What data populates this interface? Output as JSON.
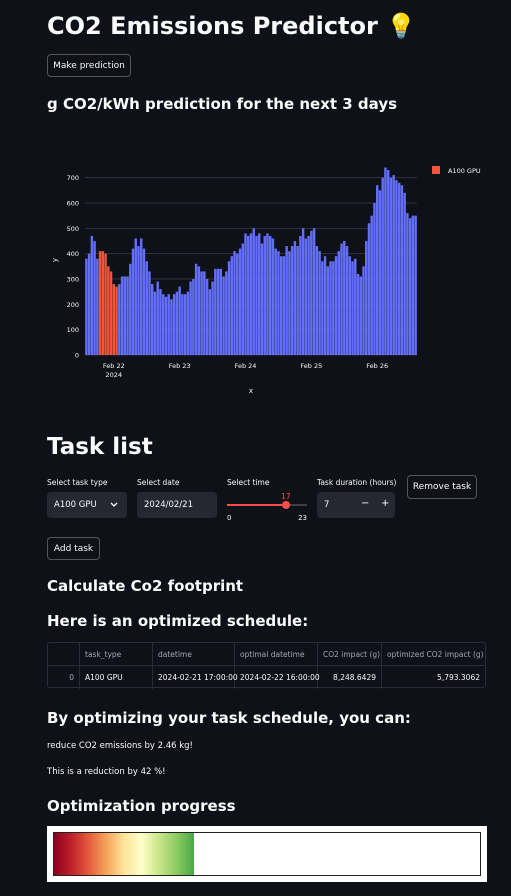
{
  "header": {
    "title": "CO2 Emissions Predictor 💡",
    "make_prediction_label": "Make prediction"
  },
  "chart_section": {
    "heading": "g CO2/kWh prediction for the next 3 days"
  },
  "chart_data": {
    "type": "bar",
    "title": "",
    "xlabel": "x",
    "ylabel": "y",
    "ylim": [
      0,
      750
    ],
    "yticks": [
      0,
      100,
      200,
      300,
      400,
      500,
      600,
      700
    ],
    "xticks": [
      {
        "hour": 10,
        "label": "Feb 22",
        "sublabel": "2024"
      },
      {
        "hour": 34,
        "label": "Feb 23",
        "sublabel": ""
      },
      {
        "hour": 58,
        "label": "Feb 24",
        "sublabel": ""
      },
      {
        "hour": 82,
        "label": "Feb 25",
        "sublabel": ""
      },
      {
        "hour": 106,
        "label": "Feb 26",
        "sublabel": ""
      }
    ],
    "x_start": "2024-02-21 14:00",
    "legend": {
      "position": "top-right",
      "entries": [
        {
          "name": "A100 GPU",
          "color": "#ef553b"
        }
      ]
    },
    "colors": {
      "bars": "#636efa",
      "highlight": "#ef553b"
    },
    "highlight_range": [
      5,
      11
    ],
    "values": [
      380,
      400,
      470,
      450,
      380,
      410,
      410,
      400,
      350,
      330,
      280,
      270,
      280,
      310,
      310,
      310,
      360,
      420,
      460,
      430,
      460,
      420,
      370,
      330,
      280,
      250,
      290,
      260,
      240,
      230,
      240,
      220,
      240,
      250,
      270,
      240,
      240,
      250,
      290,
      300,
      360,
      350,
      330,
      330,
      300,
      260,
      290,
      340,
      340,
      340,
      310,
      330,
      370,
      390,
      410,
      400,
      420,
      440,
      480,
      470,
      480,
      500,
      470,
      480,
      440,
      470,
      480,
      470,
      460,
      420,
      410,
      390,
      390,
      430,
      410,
      430,
      450,
      430,
      470,
      500,
      460,
      470,
      490,
      500,
      430,
      410,
      370,
      390,
      350,
      370,
      370,
      390,
      410,
      440,
      450,
      430,
      390,
      370,
      380,
      320,
      310,
      350,
      450,
      520,
      550,
      600,
      670,
      650,
      700,
      740,
      730,
      700,
      710,
      690,
      680,
      670,
      640,
      560,
      540,
      550,
      550
    ]
  },
  "task_list": {
    "heading": "Task list",
    "task_type_label": "Select task type",
    "task_type_value": "A100 GPU",
    "date_label": "Select date",
    "date_value": "2024/02/21",
    "time_label": "Select time",
    "time_value": "17",
    "time_min": "0",
    "time_max": "23",
    "time_fraction": 0.739,
    "duration_label": "Task duration (hours)",
    "duration_value": "7",
    "minus": "−",
    "plus": "+",
    "remove_task_label": "Remove task",
    "add_task_label": "Add task"
  },
  "footprint": {
    "heading": "Calculate Co2 footprint",
    "schedule_heading": "Here is an optimized schedule:",
    "table": {
      "columns": [
        "",
        "task_type",
        "datetime",
        "optimal datetime",
        "CO2 impact (g)",
        "optimized CO2 impact (g)"
      ],
      "rows": [
        [
          "0",
          "A100 GPU",
          "2024-02-21 17:00:00",
          "2024-02-22 16:00:00",
          "8,248.6429",
          "5,793.3062"
        ]
      ]
    }
  },
  "results": {
    "heading": "By optimizing your task schedule, you can:",
    "line1": "reduce CO2 emissions by 2.46 kg!",
    "line2": "This is a reduction by 42 %!",
    "progress_heading": "Optimization progress",
    "progress_fraction": 0.42
  }
}
